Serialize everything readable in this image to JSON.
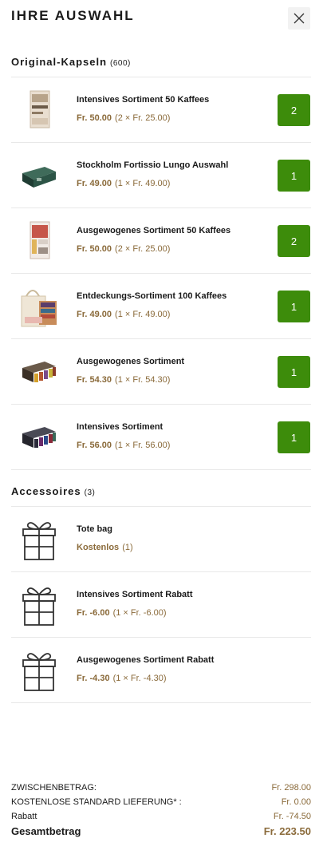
{
  "header": {
    "title": "IHRE AUSWAHL"
  },
  "capsules": {
    "heading": "Original-Kapseln",
    "count": "(600)",
    "items": [
      {
        "name": "Intensives Sortiment 50 Kaffees",
        "price": "Fr. 50.00",
        "detail": "(2 × Fr. 25.00)",
        "qty": "2",
        "icon": "product-box-image"
      },
      {
        "name": "Stockholm Fortissio Lungo Auswahl",
        "price": "Fr. 49.00",
        "detail": "(1 × Fr. 49.00)",
        "qty": "1",
        "icon": "product-box-image"
      },
      {
        "name": "Ausgewogenes Sortiment 50 Kaffees",
        "price": "Fr. 50.00",
        "detail": "(2 × Fr. 25.00)",
        "qty": "2",
        "icon": "product-box-image"
      },
      {
        "name": "Entdeckungs-Sortiment 100 Kaffees",
        "price": "Fr. 49.00",
        "detail": "(1 × Fr. 49.00)",
        "qty": "1",
        "icon": "tote-bag-image"
      },
      {
        "name": "Ausgewogenes Sortiment",
        "price": "Fr. 54.30",
        "detail": "(1 × Fr. 54.30)",
        "qty": "1",
        "icon": "capsule-sleeves-image"
      },
      {
        "name": "Intensives Sortiment",
        "price": "Fr. 56.00",
        "detail": "(1 × Fr. 56.00)",
        "qty": "1",
        "icon": "capsule-sleeves-image"
      }
    ]
  },
  "accessories": {
    "heading": "Accessoires",
    "count": "(3)",
    "items": [
      {
        "name": "Tote bag",
        "price": "Kostenlos",
        "detail": "(1)",
        "icon": "gift-icon"
      },
      {
        "name": "Intensives Sortiment Rabatt",
        "price": "Fr. -6.00",
        "detail": "(1 × Fr. -6.00)",
        "icon": "gift-icon"
      },
      {
        "name": "Ausgewogenes Sortiment Rabatt",
        "price": "Fr. -4.30",
        "detail": "(1 × Fr. -4.30)",
        "icon": "gift-icon"
      }
    ]
  },
  "summary": {
    "subtotal_label": "ZWISCHENBETRAG:",
    "subtotal_value": "Fr. 298.00",
    "shipping_label": "KOSTENLOSE STANDARD LIEFERUNG* :",
    "shipping_value": "Fr. 0.00",
    "discount_label": "Rabatt",
    "discount_value": "Fr. -74.50",
    "total_label": "Gesamtbetrag",
    "total_value": "Fr. 223.50"
  },
  "colors": {
    "accent_green": "#3d8c0b",
    "price_brown": "#8a6a3a"
  }
}
